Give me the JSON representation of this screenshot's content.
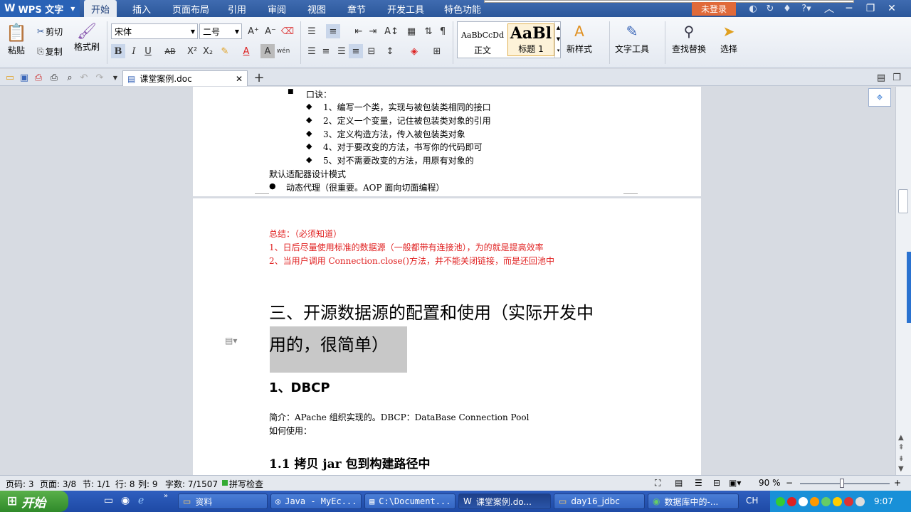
{
  "app": {
    "name": "WPS 文字",
    "login": "未登录"
  },
  "menu": [
    "开始",
    "插入",
    "页面布局",
    "引用",
    "审阅",
    "视图",
    "章节",
    "开发工具",
    "特色功能"
  ],
  "ribbon": {
    "paste": "粘贴",
    "cut": "剪切",
    "copy": "复制",
    "format_painter": "格式刷",
    "font_name": "宋体",
    "font_size": "二号",
    "style_normal_preview": "AaBbCcDd",
    "style_normal": "正文",
    "style_heading_preview": "AaBl",
    "style_heading": "标题 1",
    "new_style": "新样式",
    "text_tools": "文字工具",
    "find_replace": "查找替换",
    "select": "选择"
  },
  "doc_tab": "课堂案例.doc",
  "document": {
    "page1": {
      "koujue": "口诀：",
      "steps": [
        "1、编写一个类，实现与被包装类相同的接口",
        "2、定义一个变量，记住被包装类对象的引用",
        "3、定义构造方法，传入被包装类对象",
        "4、对于要改变的方法，书写你的代码即可",
        "5、对不需要改变的方法，用原有对象的"
      ],
      "adapter": "默认适配器设计模式",
      "dynamic_proxy": "动态代理（很重要。AOP 面向切面编程）"
    },
    "page2": {
      "summary_title": "总结：（必须知道）",
      "summary_1": "1、日后尽量使用标准的数据源（一般都带有连接池），为的就是提高效率",
      "summary_2": "2、当用户调用 Connection.close()方法，并不能关闭链接，而是还回池中",
      "heading_line1": "三、开源数据源的配置和使用（实际开发中",
      "heading_line2": "用的，很简单）",
      "dbcp_heading": "1、DBCP",
      "intro": "简介：APache 组织实现的。DBCP：DataBase Connection Pool",
      "howto": "如何使用：",
      "sub_heading": "1.1 拷贝 jar 包到构建路径中"
    }
  },
  "status": {
    "page_num": "页码: 3",
    "pages": "页面: 3/8",
    "section": "节: 1/1",
    "line": "行: 8",
    "column": "列: 9",
    "words": "字数: 7/1507",
    "spellcheck": "拼写检查",
    "zoom": "90 %"
  },
  "taskbar": {
    "start": "开始",
    "tasks": [
      "资料",
      "Java - MyEc...",
      "C:\\Document...",
      "课堂案例.do...",
      "day16_jdbc",
      "数据库中的-..."
    ],
    "lang": "CH",
    "time": "9:07"
  }
}
